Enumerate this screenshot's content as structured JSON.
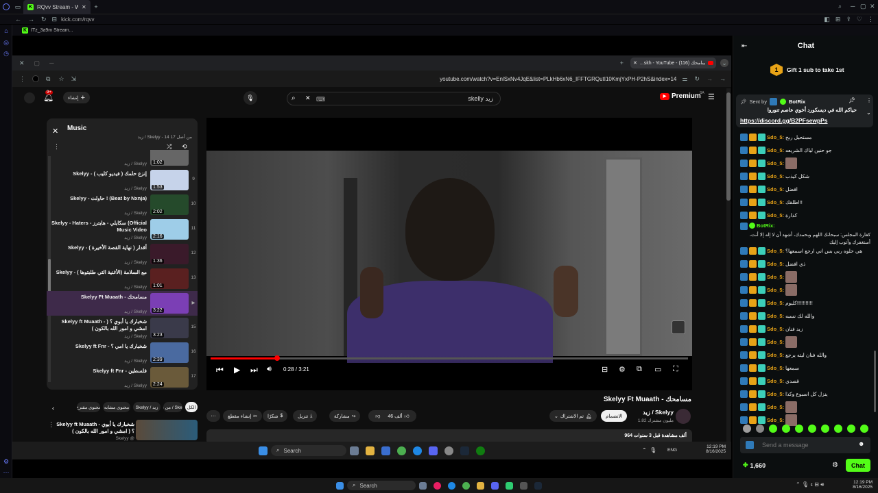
{
  "browser": {
    "tab_title": "RQvv Stream - Watch Live",
    "url": "kick.com/rqvv",
    "bookmark": "ITz_3a9m Stream..."
  },
  "inner_browser": {
    "tab_title": "...sith - YouTube - مسامحك (116)",
    "url": "youtube.com/watch?v=EnlSxNv4JqE&list=PLkHb6xN6_IFFTGRQutI10KmjYxPH-P2hS&index=14"
  },
  "youtube": {
    "create_label": "إنشاء",
    "notif_count": "9+",
    "search_value": "skelly زيد",
    "logo": "Premium",
    "logo_region": "SA",
    "playlist": {
      "title": "Music",
      "subtitle": "زيد / Skelyy - 14 من أصل 17",
      "items": [
        {
          "num": "",
          "title": "",
          "channel": "زيد / Skelyy",
          "dur": "1:02"
        },
        {
          "num": "9",
          "title": "Skelyy - إنزع حلمك ( فيديو كليب )",
          "channel": "زيد / Skelyy",
          "dur": "1:53"
        },
        {
          "num": "10",
          "title": "Skelyy - حاولت ! (Beat by Nxnja)",
          "channel": "زيد / Skelyy",
          "dur": "2:02"
        },
        {
          "num": "11",
          "title": "Skelyy - Haters - سكايلي - هايترز (Official Music Video",
          "channel": "زيد / Skelyy",
          "dur": "2:16"
        },
        {
          "num": "12",
          "title": "Skelyy - أقدار ( نهاية القصة الأخيرة )",
          "channel": "زيد / Skelyy",
          "dur": "1:36"
        },
        {
          "num": "13",
          "title": "Skelyy - مع السلامة (الأغنية التي طلبتوها )",
          "channel": "زيد / Skelyy",
          "dur": "1:01"
        },
        {
          "num": "▶",
          "title": "Skelyy Ft Muaath - مسامحك",
          "channel": "زيد / Skelyy",
          "dur": "3:22"
        },
        {
          "num": "15",
          "title": "Skelyy ft Muaath - شخبارك يا أبوي ؟ ( امشي و امور الله بالكون )",
          "channel": "زيد / Skelyy",
          "dur": "3:23"
        },
        {
          "num": "16",
          "title": "Skelyy ft Fnr - شخبارك يا امي ؟",
          "channel": "زيد / Skelyy",
          "dur": "2:39"
        },
        {
          "num": "17",
          "title": "Skelyy ft Fnr - فلسطين",
          "channel": "زيد / Skelyy",
          "dur": "2:24"
        }
      ]
    },
    "player": {
      "time": "0:28 / 3:21",
      "progress": 0.139
    },
    "video_title": "Skelyy Ft Muaath - مسامحك",
    "channel_name": "زيد / Skelyy",
    "subscribers": "1.82 مليون مشترك",
    "join_label": "الانضمام",
    "subscribed_label": "تم الاشتراك",
    "likes": "46 ألف",
    "share_label": "مشاركة",
    "download_label": "تنزيل",
    "thanks_label": "شكرًا",
    "clip_label": "إنشاء مقطع",
    "views": "964 ألف مشاهدة قبل 3 سنوات",
    "chips": [
      "الكل",
      "من زيد / Skelyy",
      "Skelyy / زيد",
      "محتوى مشابه",
      "محتوى مقترح"
    ],
    "rec_title": "Skelyy ft Muaath - شخبارك يا أبوي ؟ ( امشي و امور الله بالكون )",
    "rec_channel": "Skelyy @"
  },
  "inner_taskbar": {
    "search": "Search",
    "time": "12:19 PM",
    "date": "8/16/2025",
    "lang": "ENG"
  },
  "chat": {
    "title": "Chat",
    "gift_rank": "1",
    "gift_text": "Gift 1 sub to take 1st",
    "pinned_sent_by": "Sent by",
    "pinned_user": "BotRix",
    "pinned_text": "حياكم الله في ديسكورد أخوي عاصم تنوروا",
    "pinned_link": "https://discord.gg/B2PFsewpPs",
    "messages": [
      {
        "user": "Sdo_5:",
        "text": "مستحيل ربح",
        "emote": false
      },
      {
        "user": "Sdo_5:",
        "text": "جو حنين لياك الشريعه",
        "emote": false
      },
      {
        "user": "Sdo_5:",
        "text": "",
        "emote": true
      },
      {
        "user": "Sdo_5:",
        "text": "شكل كيذب",
        "emote": false
      },
      {
        "user": "Sdo_5:",
        "text": "افضل",
        "emote": false
      },
      {
        "user": "Sdo_5:",
        "text": "اطلقك!!",
        "emote": false
      },
      {
        "user": "Sdo_5:",
        "text": "كذارة",
        "emote": false
      }
    ],
    "botrix_user": "BotRix:",
    "botrix_text": "كفارة المجلس: سبحانك اللهم وبحمدك، أشهد أن لا إله إلا أنت، أستغفرك وأتوب إليك",
    "messages2": [
      {
        "user": "Sdo_5:",
        "text": "هي حلوه ربي بس اني ارجع اسمعها؟",
        "emote": false
      },
      {
        "user": "Sdo_5:",
        "text": "ذي افضل",
        "emote": false
      },
      {
        "user": "Sdo_5:",
        "text": "",
        "emote": true
      },
      {
        "user": "Sdo_5:",
        "text": "",
        "emote": true
      },
      {
        "user": "Sdo_5:",
        "text": "كليوم!!!!!!!!!!!",
        "emote": false
      },
      {
        "user": "Sdo_5:",
        "text": "والله لك نسبه",
        "emote": false
      },
      {
        "user": "Sdo_5:",
        "text": "زيد فنان",
        "emote": false
      },
      {
        "user": "Sdo_5:",
        "text": "",
        "emote": true
      },
      {
        "user": "Sdo_5:",
        "text": "والله فنان ليته يرجع",
        "emote": false
      },
      {
        "user": "Sdo_5:",
        "text": "سمعها",
        "emote": false
      },
      {
        "user": "Sdo_5:",
        "text": "قصدي",
        "emote": false
      },
      {
        "user": "Sdo_5:",
        "text": "ينزل كل اسبوع وكذا",
        "emote": false
      },
      {
        "user": "Sdo_5:",
        "text": "",
        "emote": true
      },
      {
        "user": "Sdo_5:",
        "text": "",
        "emote": true
      }
    ],
    "input_placeholder": "Send a message",
    "points": "1,660",
    "chat_button": "Chat"
  },
  "os_taskbar": {
    "search": "Search",
    "time": "12:19 PM",
    "date": "8/16/2025"
  },
  "colors": {
    "kick_green": "#53fc18",
    "yt_red": "#ff0000",
    "username_gold": "#e8a317"
  }
}
